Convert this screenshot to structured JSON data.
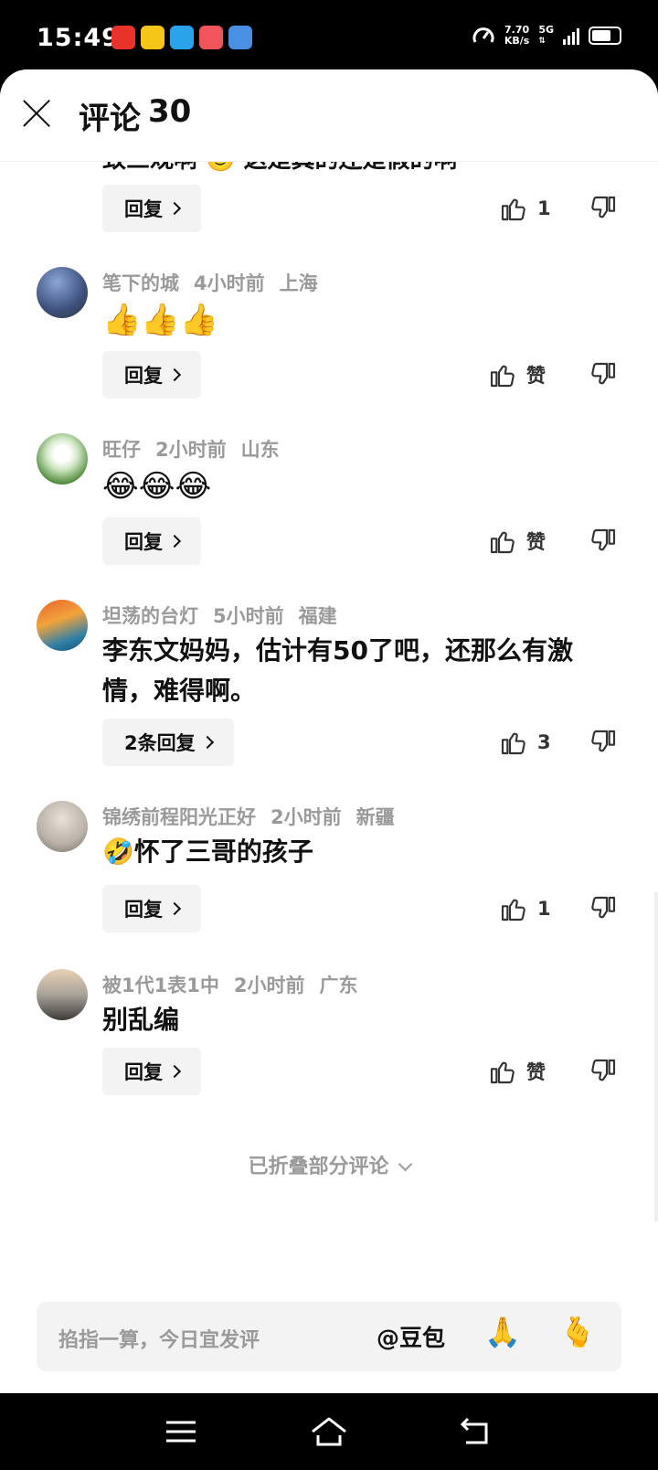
{
  "status_bar": {
    "time": "15:49",
    "speed_value": "7.70",
    "speed_unit": "KB/s",
    "network": "5G"
  },
  "header": {
    "title_label": "评论",
    "comment_count": "30"
  },
  "partial_comment": {
    "text": "致三观啊 🙂 这是真的还是假的啊",
    "like_count": "1",
    "reply_label": "回复"
  },
  "comments": [
    {
      "user": "笔下的城",
      "time": "4小时前",
      "location": "上海",
      "text": "👍👍👍",
      "reply_label": "回复",
      "likes": "赞"
    },
    {
      "user": "旺仔",
      "time": "2小时前",
      "location": "山东",
      "text": "😂😂😂",
      "reply_label": "回复",
      "likes": "赞"
    },
    {
      "user": "坦荡的台灯",
      "time": "5小时前",
      "location": "福建",
      "text": "李东文妈妈，估计有50了吧，还那么有激情，难得啊。",
      "reply_label": "2条回复",
      "likes": "3"
    },
    {
      "user": "锦绣前程阳光正好",
      "time": "2小时前",
      "location": "新疆",
      "text": "🤣怀了三哥的孩子",
      "reply_label": "回复",
      "likes": "1"
    },
    {
      "user": "被1代1表1中",
      "time": "2小时前",
      "location": "广东",
      "text": "别乱编",
      "reply_label": "回复",
      "likes": "赞"
    }
  ],
  "folded_label": "已折叠部分评论",
  "input": {
    "placeholder": "掐指一算，今日宜发评",
    "mention": "@豆包",
    "emoji_1": "🙏",
    "emoji_2": "🫰"
  },
  "colors": {
    "meta_gray": "#9a9a9a",
    "button_bg": "#f3f3f3"
  }
}
